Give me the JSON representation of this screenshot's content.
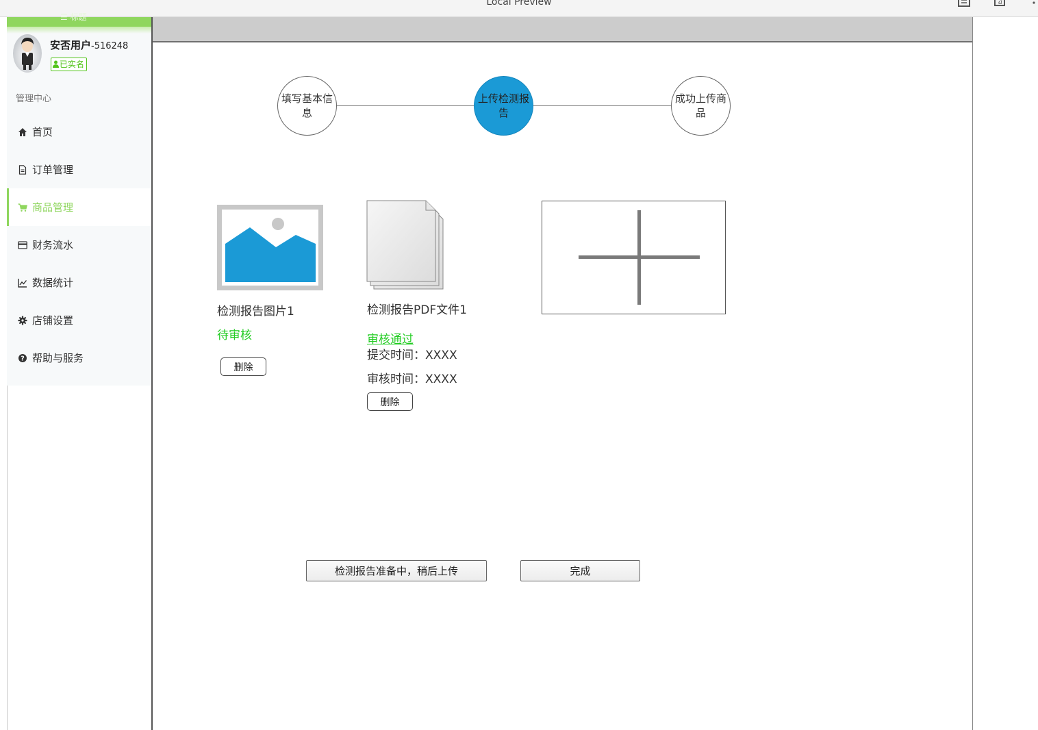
{
  "window": {
    "title": "Local Preview",
    "icons": [
      "document-icon",
      "text-edit-icon",
      "more-icon"
    ]
  },
  "sidebar": {
    "banner_text": "☰ 标题",
    "user": {
      "name": "安否用户",
      "id": "-516248",
      "verified_label": "已实名"
    },
    "section_label": "管理中心",
    "items": [
      {
        "label": "首页",
        "icon": "home-icon",
        "active": false
      },
      {
        "label": "订单管理",
        "icon": "document-icon",
        "active": false
      },
      {
        "label": "商品管理",
        "icon": "cart-icon",
        "active": true
      },
      {
        "label": "财务流水",
        "icon": "card-icon",
        "active": false
      },
      {
        "label": "数据统计",
        "icon": "chart-icon",
        "active": false
      },
      {
        "label": "店铺设置",
        "icon": "gear-icon",
        "active": false
      },
      {
        "label": "帮助与服务",
        "icon": "help-icon",
        "active": false
      }
    ],
    "accent_color": "#8fd65e"
  },
  "steps": [
    {
      "label": "填写基本信息",
      "current": false
    },
    {
      "label": "上传检测报告",
      "current": true
    },
    {
      "label": "成功上传商品",
      "current": false
    }
  ],
  "step_current_color": "#1b9ad6",
  "attachments": [
    {
      "type": "image",
      "name": "检测报告图片1",
      "status": "待审核",
      "delete_label": "删除"
    },
    {
      "type": "pdf",
      "name": "检测报告PDF文件1",
      "status": "审核通过",
      "submit_time": "提交时间：XXXX",
      "review_time": "审核时间：XXXX",
      "delete_label": "删除"
    }
  ],
  "status_color": "#22cc22",
  "add_button_icon": "plus-icon",
  "actions": {
    "later_label": "检测报告准备中，稍后上传",
    "done_label": "完成"
  }
}
